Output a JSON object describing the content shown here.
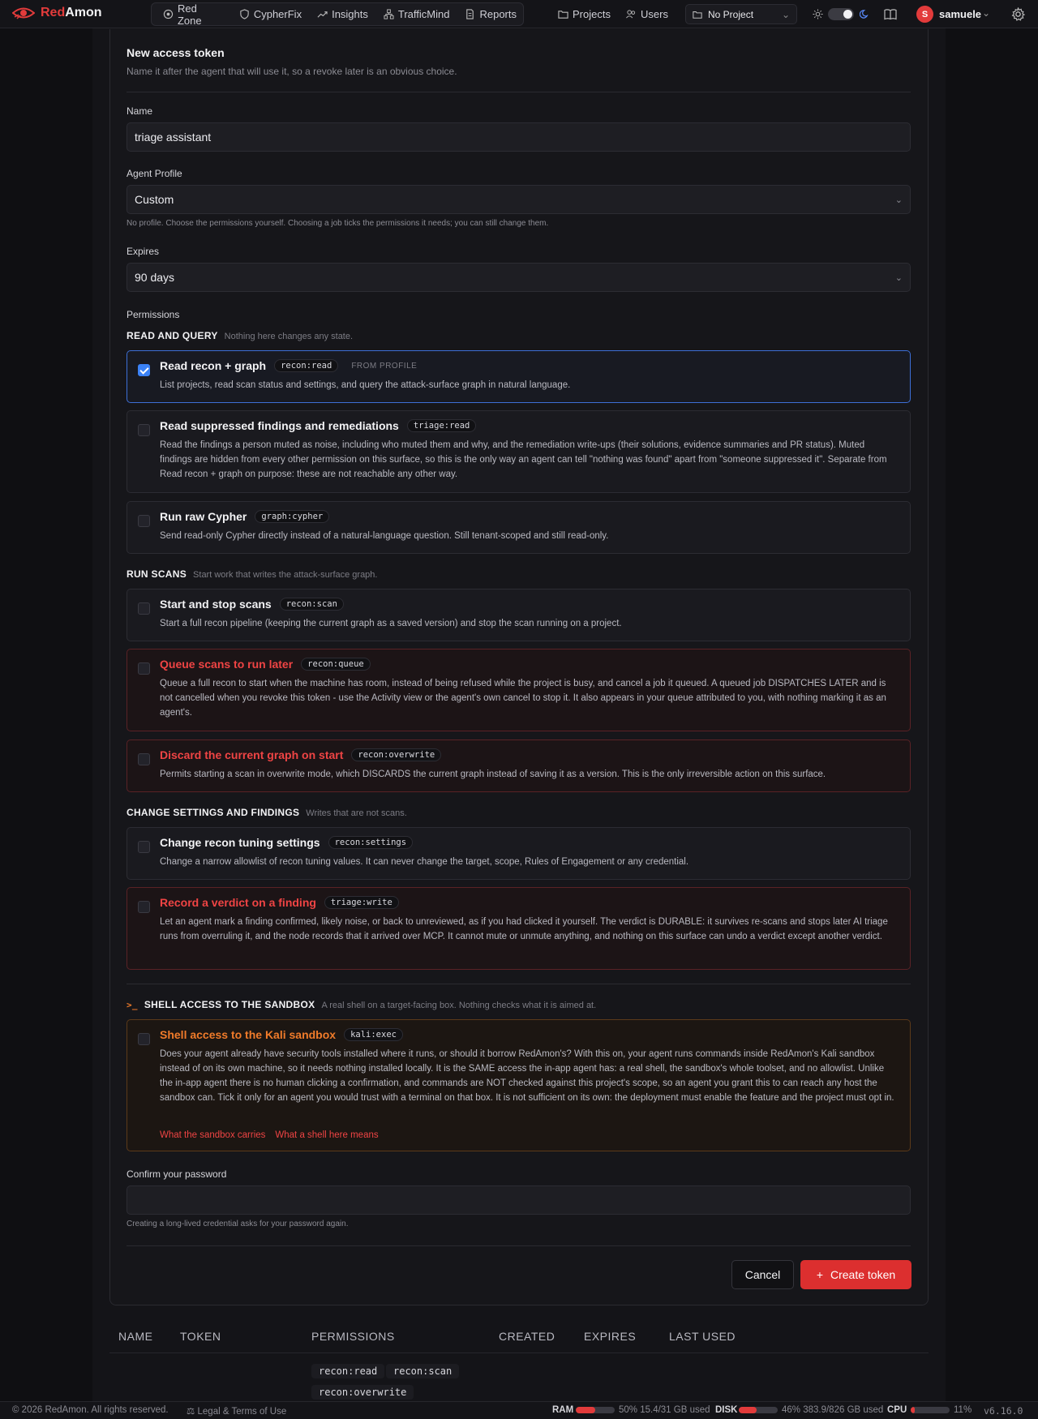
{
  "nav": {
    "brand_red": "Red",
    "brand_white": "Amon",
    "items": [
      "Red Zone",
      "CypherFix",
      "Insights",
      "TrafficMind",
      "Reports"
    ],
    "projects": "Projects",
    "users": "Users",
    "project_select": "No Project",
    "user_initial": "S",
    "username": "samuele"
  },
  "form": {
    "title": "New access token",
    "subtitle": "Name it after the agent that will use it, so a revoke later is an obvious choice.",
    "name_label": "Name",
    "name_value": "triage assistant",
    "profile_label": "Agent Profile",
    "profile_value": "Custom",
    "profile_hint": "No profile. Choose the permissions yourself. Choosing a job ticks the permissions it needs; you can still change them.",
    "expires_label": "Expires",
    "expires_value": "90 days",
    "permissions_label": "Permissions"
  },
  "sections": {
    "read": {
      "title": "READ AND QUERY",
      "desc": "Nothing here changes any state."
    },
    "scans": {
      "title": "RUN SCANS",
      "desc": "Start work that writes the attack-surface graph."
    },
    "settings": {
      "title": "CHANGE SETTINGS AND FINDINGS",
      "desc": "Writes that are not scans."
    },
    "shell": {
      "prompt": ">_",
      "title": "SHELL ACCESS TO THE SANDBOX",
      "desc": "A real shell on a target-facing box. Nothing checks what it is aimed at."
    }
  },
  "perms": [
    {
      "title": "Read recon + graph",
      "scope": "recon:read",
      "tag": "FROM PROFILE",
      "checked": true,
      "desc": "List projects, read scan status and settings, and query the attack-surface graph in natural language."
    },
    {
      "title": "Read suppressed findings and remediations",
      "scope": "triage:read",
      "checked": false,
      "desc": "Read the findings a person muted as noise, including who muted them and why, and the remediation write-ups (their solutions, evidence summaries and PR status). Muted findings are hidden from every other permission on this surface, so this is the only way an agent can tell \"nothing was found\" apart from \"someone suppressed it\". Separate from Read recon + graph on purpose: these are not reachable any other way."
    },
    {
      "title": "Run raw Cypher",
      "scope": "graph:cypher",
      "checked": false,
      "desc": "Send read-only Cypher directly instead of a natural-language question. Still tenant-scoped and still read-only."
    },
    {
      "title": "Start and stop scans",
      "scope": "recon:scan",
      "checked": false,
      "desc": "Start a full recon pipeline (keeping the current graph as a saved version) and stop the scan running on a project."
    },
    {
      "title": "Queue scans to run later",
      "scope": "recon:queue",
      "checked": false,
      "desc": "Queue a full recon to start when the machine has room, instead of being refused while the project is busy, and cancel a job it queued. A queued job DISPATCHES LATER and is not cancelled when you revoke this token - use the Activity view or the agent's own cancel to stop it. It also appears in your queue attributed to you, with nothing marking it as an agent's."
    },
    {
      "title": "Discard the current graph on start",
      "scope": "recon:overwrite",
      "checked": false,
      "desc": "Permits starting a scan in overwrite mode, which DISCARDS the current graph instead of saving it as a version. This is the only irreversible action on this surface."
    },
    {
      "title": "Change recon tuning settings",
      "scope": "recon:settings",
      "checked": false,
      "desc": "Change a narrow allowlist of recon tuning values. It can never change the target, scope, Rules of Engagement or any credential."
    },
    {
      "title": "Record a verdict on a finding",
      "scope": "triage:write",
      "checked": false,
      "desc": "Let an agent mark a finding confirmed, likely noise, or back to unreviewed, as if you had clicked it yourself. The verdict is DURABLE: it survives re-scans and stops later AI triage runs from overruling it, and the node records that it arrived over MCP. It cannot mute or unmute anything, and nothing on this surface can undo a verdict except another verdict."
    },
    {
      "title": "Shell access to the Kali sandbox",
      "scope": "kali:exec",
      "checked": false,
      "desc": "Does your agent already have security tools installed where it runs, or should it borrow RedAmon's? With this on, your agent runs commands inside RedAmon's Kali sandbox instead of on its own machine, so it needs nothing installed locally. It is the SAME access the in-app agent has: a real shell, the sandbox's whole toolset, and no allowlist. Unlike the in-app agent there is no human clicking a confirmation, and commands are NOT checked against this project's scope, so an agent you grant this to can reach any host the sandbox can. Tick it only for an agent you would trust with a terminal on that box. It is not sufficient on its own: the deployment must enable the feature and the project must opt in.",
      "link1": "What the sandbox carries",
      "link2": "What a shell here means"
    }
  ],
  "confirm": {
    "label": "Confirm your password",
    "value": "",
    "hint": "Creating a long-lived credential asks for your password again."
  },
  "actions": {
    "cancel": "Cancel",
    "create_icon": "+",
    "create": "Create token"
  },
  "table": {
    "headers": [
      "NAME",
      "TOKEN",
      "PERMISSIONS",
      "CREATED",
      "EXPIRES",
      "LAST USED"
    ],
    "row_scopes": [
      "recon:read",
      "recon:scan",
      "recon:overwrite"
    ]
  },
  "footer": {
    "copyright": "© 2026 RedAmon. All rights reserved.",
    "legal": "Legal & Terms of Use",
    "ram_label": "RAM",
    "ram_text": "50% 15.4/31 GB used",
    "ram_pct": 50,
    "disk_label": "DISK",
    "disk_text": "46% 383.9/826 GB used",
    "disk_pct": 46,
    "cpu_label": "CPU",
    "cpu_text": "11%",
    "cpu_pct": 11,
    "version": "v6.16.0"
  },
  "colors": {
    "accent": "#dc2f2f",
    "checkbox": "#3b82f6",
    "danger": "#ef4444",
    "shell": "#f07b2a"
  }
}
